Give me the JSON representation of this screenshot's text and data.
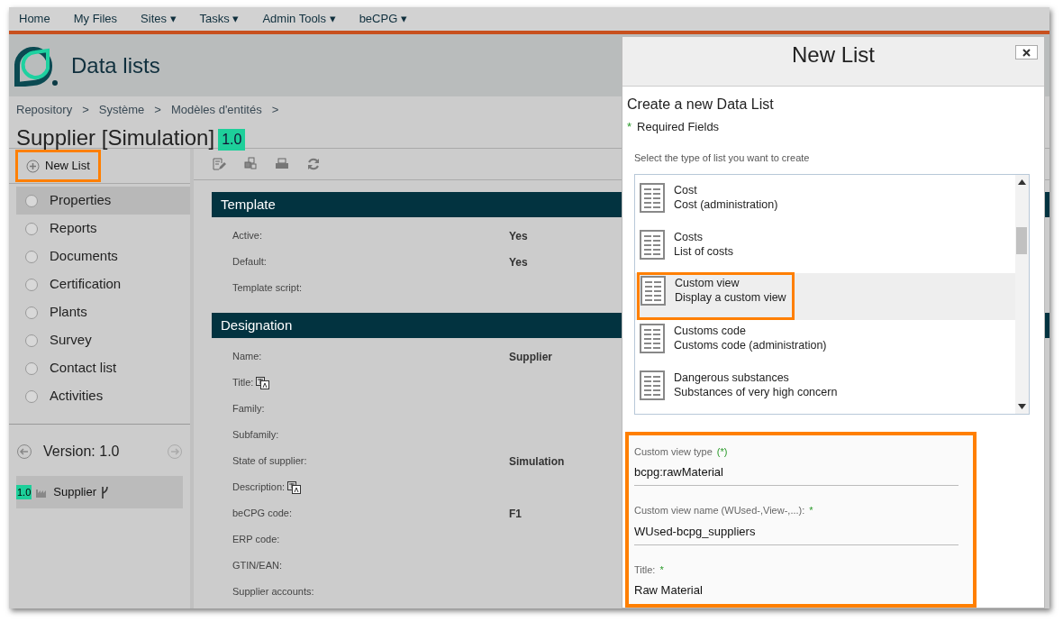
{
  "nav": [
    {
      "label": "Home",
      "dropdown": false
    },
    {
      "label": "My Files",
      "dropdown": false
    },
    {
      "label": "Sites",
      "dropdown": true
    },
    {
      "label": "Tasks",
      "dropdown": true
    },
    {
      "label": "Admin Tools",
      "dropdown": true
    },
    {
      "label": "beCPG",
      "dropdown": true
    }
  ],
  "dropdown_caret": "▾",
  "header": {
    "title": "Data lists"
  },
  "breadcrumb": {
    "items": [
      "Repository",
      "Système",
      "Modèles d'entités"
    ],
    "separator": ">"
  },
  "entity": {
    "title": "Supplier [Simulation]",
    "version": "1.0"
  },
  "new_list_button": {
    "label": "New List",
    "highlighted": true
  },
  "sidebar": {
    "items": [
      {
        "label": "Properties",
        "selected": true
      },
      {
        "label": "Reports",
        "selected": false
      },
      {
        "label": "Documents",
        "selected": false
      },
      {
        "label": "Certification",
        "selected": false
      },
      {
        "label": "Plants",
        "selected": false
      },
      {
        "label": "Survey",
        "selected": false
      },
      {
        "label": "Contact list",
        "selected": false
      },
      {
        "label": "Activities",
        "selected": false
      }
    ]
  },
  "version": {
    "label": "Version: 1.0",
    "item_badge": "1.0",
    "item_label": "Supplier"
  },
  "sections": [
    {
      "title": "Template",
      "fields": [
        {
          "label": "Active:",
          "value": "Yes",
          "translatable": false
        },
        {
          "label": "Default:",
          "value": "Yes",
          "translatable": false
        },
        {
          "label": "Template script:",
          "translatable": false
        }
      ]
    },
    {
      "title": "Designation",
      "fields": [
        {
          "label": "Name:",
          "value": "Supplier",
          "translatable": false
        },
        {
          "label": "Title:",
          "translatable": true
        },
        {
          "label": "Family:",
          "translatable": false
        },
        {
          "label": "Subfamily:",
          "translatable": false
        },
        {
          "label": "State of supplier:",
          "value": "Simulation",
          "translatable": false
        },
        {
          "label": "Description:",
          "translatable": true
        },
        {
          "label": "beCPG code:",
          "value": "F1",
          "translatable": false
        },
        {
          "label": "ERP code:",
          "translatable": false
        },
        {
          "label": "GTIN/EAN:",
          "translatable": false
        },
        {
          "label": "Supplier accounts:",
          "translatable": false
        }
      ]
    }
  ],
  "dialog": {
    "title": "New List",
    "heading": "Create a new Data List",
    "required_mark": "*",
    "required_note": "Required Fields",
    "prompt": "Select the type of list you want to create",
    "list_types": [
      {
        "name": "Cost",
        "description": "Cost (administration)",
        "selected": false
      },
      {
        "name": "Costs",
        "description": "List of costs",
        "selected": false
      },
      {
        "name": "Custom view",
        "description": "Display a custom view",
        "selected": true
      },
      {
        "name": "Customs code",
        "description": "Customs code (administration)",
        "selected": false
      },
      {
        "name": "Dangerous substances",
        "description": "Substances of very high concern",
        "selected": false
      }
    ],
    "form": {
      "highlighted": true,
      "fields": [
        {
          "label": "Custom view type",
          "required_mark": "(*)",
          "value": "bcpg:rawMaterial"
        },
        {
          "label": "Custom view name (WUsed-,View-,...):",
          "required_mark": "*",
          "value": "WUsed-bcpg_suppliers"
        },
        {
          "label": "Title:",
          "required_mark": "*",
          "value": "Raw Material"
        }
      ]
    }
  }
}
